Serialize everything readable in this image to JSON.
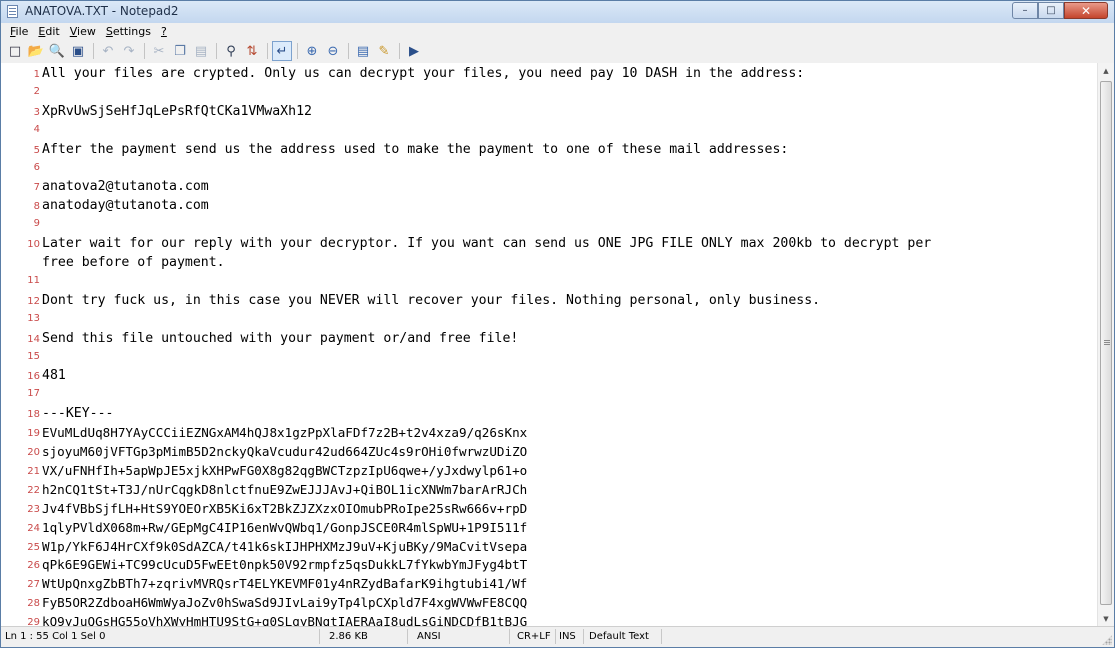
{
  "window": {
    "title": "ANATOVA.TXT - Notepad2",
    "minimize": "–",
    "maximize": "□",
    "close": "✕"
  },
  "menu": [
    {
      "key": "F",
      "rest": "ile"
    },
    {
      "key": "E",
      "rest": "dit"
    },
    {
      "key": "V",
      "rest": "iew"
    },
    {
      "key": "S",
      "rest": "ettings"
    },
    {
      "key": "?",
      "rest": ""
    }
  ],
  "toolbar": {
    "icons": [
      "new-icon",
      "open-icon",
      "browse-icon",
      "save-icon",
      "undo-icon",
      "redo-icon",
      "cut-icon",
      "copy-icon",
      "paste-icon",
      "find-icon",
      "replace-icon",
      "word-wrap-icon",
      "zoom-in-icon",
      "zoom-out-icon",
      "scheme-icon",
      "customize-icon",
      "exit-icon"
    ]
  },
  "editor": {
    "lines": [
      {
        "n": "1",
        "t": "All your files are crypted. Only us can decrypt your files, you need pay 10 DASH in the address:"
      },
      {
        "n": "2",
        "t": ""
      },
      {
        "n": "3",
        "t": "XpRvUwSjSeHfJqLePsRfQtCKa1VMwaXh12"
      },
      {
        "n": "4",
        "t": ""
      },
      {
        "n": "5",
        "t": "After the payment send us the address used to make the payment to one of these mail addresses:"
      },
      {
        "n": "6",
        "t": ""
      },
      {
        "n": "7",
        "t": "anatova2@tutanota.com"
      },
      {
        "n": "8",
        "t": "anatoday@tutanota.com"
      },
      {
        "n": "9",
        "t": ""
      },
      {
        "n": "10",
        "t": "Later wait for our reply with your decryptor. If you want can send us ONE JPG FILE ONLY max 200kb to decrypt per"
      },
      {
        "n": "",
        "t": "free before of payment."
      },
      {
        "n": "11",
        "t": ""
      },
      {
        "n": "12",
        "t": "Dont try fuck us, in this case you NEVER will recover your files. Nothing personal, only business."
      },
      {
        "n": "13",
        "t": ""
      },
      {
        "n": "14",
        "t": "Send this file untouched with your payment or/and free file!"
      },
      {
        "n": "15",
        "t": ""
      },
      {
        "n": "16",
        "t": "481"
      },
      {
        "n": "17",
        "t": ""
      },
      {
        "n": "18",
        "t": "---KEY---"
      },
      {
        "n": "19",
        "t": "EVuMLdUq8H7YAyCCCiiEZNGxAM4hQJ8x1gzPpXlaFDf7z2B+t2v4xza9/q26sKnx"
      },
      {
        "n": "20",
        "t": "sjoyuM60jVFTGp3pMimB5D2nckyQkaVcudur42ud664ZUc4s9rOHi0fwrwzUDiZO"
      },
      {
        "n": "21",
        "t": "VX/uFNHfIh+5apWpJE5xjkXHPwFG0X8g82qgBWCTzpzIpU6qwe+/yJxdwylp61+o"
      },
      {
        "n": "22",
        "t": "h2nCQ1tSt+T3J/nUrCqgkD8nlctfnuE9ZwEJJJAvJ+QiBOL1icXNWm7barArRJCh"
      },
      {
        "n": "23",
        "t": "Jv4fVBbSjfLH+HtS9YOEOrXB5Ki6xT2BkZJZXzxOIOmubPRoIpe25sRw666v+rpD"
      },
      {
        "n": "24",
        "t": "1qlyPVldX068m+Rw/GEpMgC4IP16enWvQWbq1/GonpJSCE0R4mlSpWU+1P9I511f"
      },
      {
        "n": "25",
        "t": "W1p/YkF6J4HrCXf9k0SdAZCA/t41k6skIJHPHXMzJ9uV+KjuBKy/9MaCvitVsepa"
      },
      {
        "n": "26",
        "t": "qPk6E9GEWi+TC99cUcuD5FwEEt0npk50V92rmpfz5qsDukkL7fYkwbYmJFyg4btT"
      },
      {
        "n": "27",
        "t": "WtUpQnxgZbBTh7+zqrivMVRQsrT4ELYKEVMF01y4nRZydBafarK9ihgtubi41/Wf"
      },
      {
        "n": "28",
        "t": "FyB5OR2ZdboaH6WmWyaJoZv0hSwaSd9JIvLai9yTp4lpCXpld7F4xgWVWwFE8CQQ"
      },
      {
        "n": "29",
        "t": "kQ9yJuQGsHG55oVhXWyHmHTU9StG+q0SLgyBNqtIAERAaI8udLsGiNDCDfB1tBJG"
      }
    ]
  },
  "status": {
    "position": "Ln 1 : 55  Col 1  Sel 0",
    "size": "2.86 KB",
    "encoding": "ANSI",
    "eol": "CR+LF",
    "mode": "INS",
    "scheme": "Default Text"
  }
}
